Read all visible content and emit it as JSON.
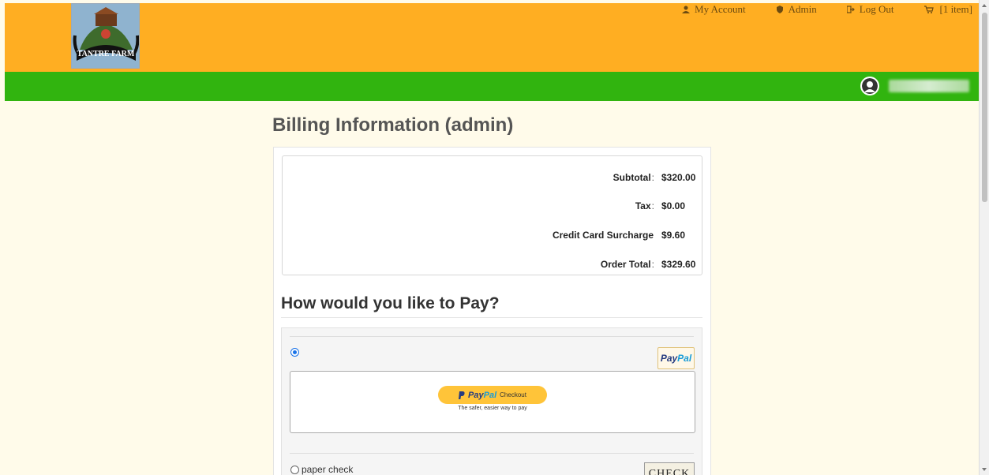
{
  "brand": {
    "logo_text": "TANTRE FARM"
  },
  "topnav": {
    "my_account": "My Account",
    "admin": "Admin",
    "log_out": "Log Out",
    "cart": "[1 item]"
  },
  "page": {
    "title": "Billing Information (admin)"
  },
  "totals": {
    "rows": [
      {
        "label": "Subtotal",
        "colon": ":",
        "value": "$320.00"
      },
      {
        "label": "Tax",
        "colon": ":",
        "value": "$0.00"
      },
      {
        "label": "Credit Card Surcharge",
        "colon": "",
        "value": "$9.60"
      },
      {
        "label": "Order Total",
        "colon": ":",
        "value": "$329.60"
      }
    ]
  },
  "payment": {
    "heading": "How would you like to Pay?",
    "paypal": {
      "badge_pay": "Pay",
      "badge_pal": "Pal",
      "button_pay": "Pay",
      "button_pal": "Pal",
      "button_checkout": "Checkout",
      "tagline": "The safer, easier way to pay"
    },
    "check": {
      "label": "paper check",
      "badge": "CHECK"
    }
  },
  "colors": {
    "header": "#ffae22",
    "nav": "#31b40f",
    "background": "#fffbea",
    "paypal_button": "#ffc439"
  }
}
